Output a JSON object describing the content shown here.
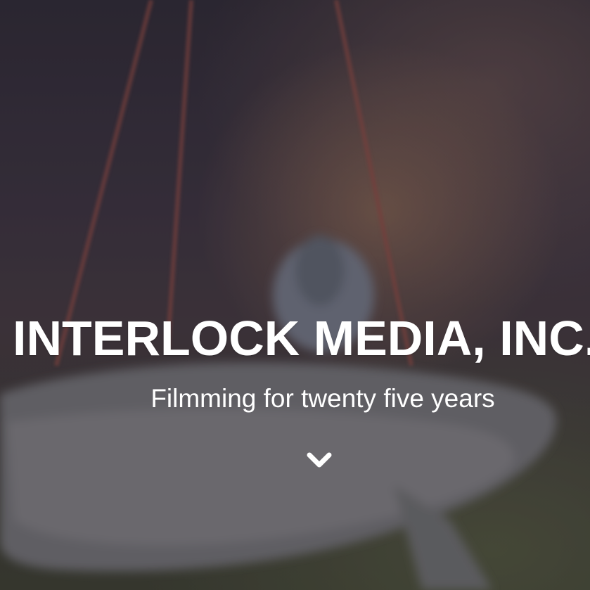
{
  "hero": {
    "title": "INTERLOCK MEDIA, INC.",
    "subtitle": "Filmming for twenty five years",
    "scroll_icon": "chevron-down-icon"
  },
  "colors": {
    "text": "#ffffff",
    "background": "#3b3340"
  }
}
